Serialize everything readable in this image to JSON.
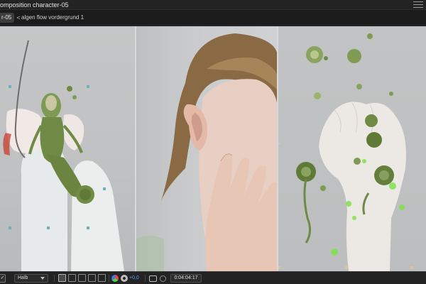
{
  "window": {
    "title": "omposition character-05"
  },
  "tabs": {
    "active_tab_label": "r-05",
    "arrow_glyph": "<",
    "breadcrumb": "algen flow vordergrund 1"
  },
  "viewer": {
    "panels": [
      {
        "name": "left-panel",
        "content": "green sea creature figure held by arm"
      },
      {
        "name": "middle-panel",
        "content": "portrait with hand on face"
      },
      {
        "name": "right-panel",
        "content": "hand holding green algae creatures"
      }
    ]
  },
  "toolbar": {
    "checkbox_glyph": "✓",
    "resolution_select": "Halb",
    "exposure_value": "+0,0",
    "timecode": "0:04:04:17",
    "icons": [
      "region-of-interest-icon",
      "transparency-grid-icon",
      "mask-view-icon",
      "snapshot-display-icon",
      "guides-icon",
      "color-channel-icon",
      "exposure-reset-icon",
      "camera-snapshot-icon",
      "show-snapshot-icon"
    ]
  },
  "colors": {
    "accent_blue": "#5a9bf0",
    "background": "#1e1e1e",
    "creature_green": "#6f8a44"
  }
}
